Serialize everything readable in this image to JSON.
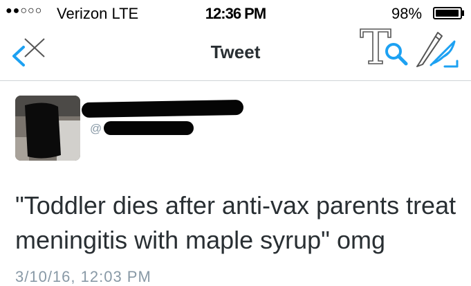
{
  "status_bar": {
    "signal": "●●○○○",
    "carrier": "Verizon  LTE",
    "time": "12:36 PM",
    "battery_percent": "98%",
    "battery_level": 0.98
  },
  "nav": {
    "title": "Tweet",
    "icons": {
      "back": "chevron-left-icon",
      "close": "close-icon",
      "text_tool": "text-search-icon",
      "compose": "compose-quill-icon"
    },
    "accent_color": "#1da1f2"
  },
  "tweet": {
    "handle_prefix": "@",
    "text": "\"Toddler dies after anti-vax parents treat meningitis with maple syrup\" omg",
    "timestamp": "3/10/16, 12:03 PM"
  }
}
